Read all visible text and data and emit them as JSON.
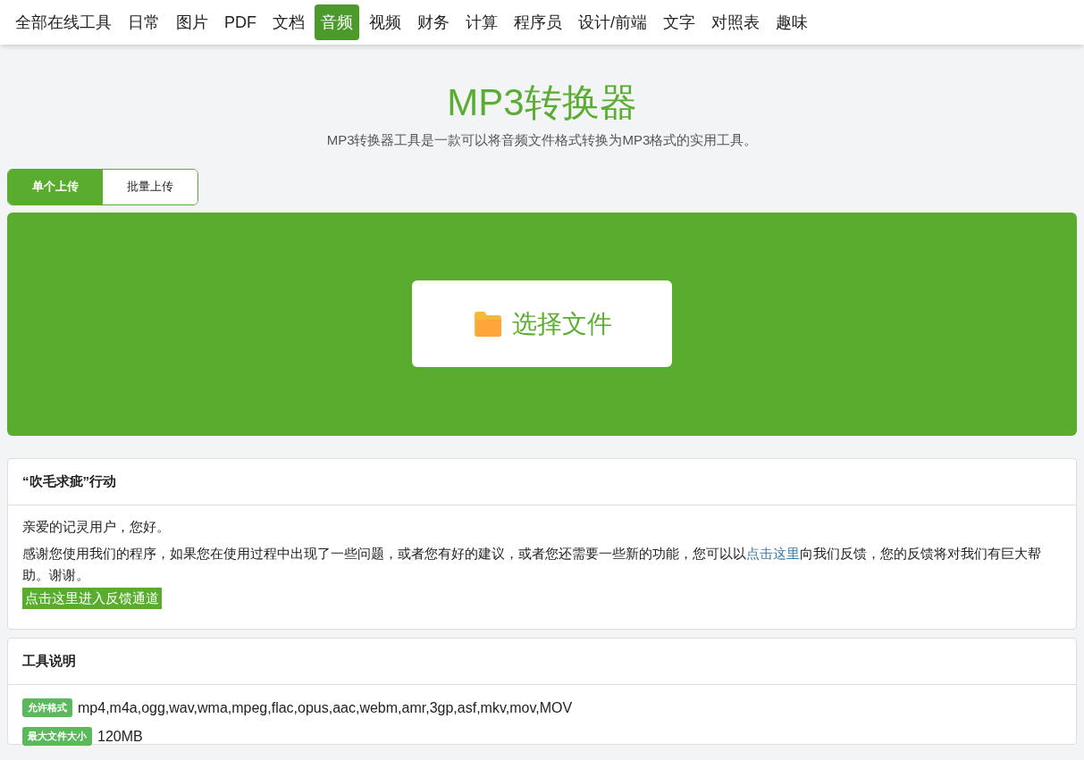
{
  "nav": [
    {
      "label": "全部在线工具",
      "selected": false
    },
    {
      "label": "日常",
      "selected": false
    },
    {
      "label": "图片",
      "selected": false
    },
    {
      "label": "PDF",
      "selected": false
    },
    {
      "label": "文档",
      "selected": false
    },
    {
      "label": "音频",
      "selected": true
    },
    {
      "label": "视频",
      "selected": false
    },
    {
      "label": "财务",
      "selected": false
    },
    {
      "label": "计算",
      "selected": false
    },
    {
      "label": "程序员",
      "selected": false
    },
    {
      "label": "设计/前端",
      "selected": false
    },
    {
      "label": "文字",
      "selected": false
    },
    {
      "label": "对照表",
      "selected": false
    },
    {
      "label": "趣味",
      "selected": false
    }
  ],
  "title": "MP3转换器",
  "subtitle": "MP3转换器工具是一款可以将音频文件格式转换为MP3格式的实用工具。",
  "upload_tabs": [
    {
      "label": "单个上传",
      "selected": true
    },
    {
      "label": "批量上传",
      "selected": false
    }
  ],
  "upload_button": "选择文件",
  "feedback_card": {
    "title": "“吹毛求疵”行动",
    "greeting": "亲爱的记灵用户，您好。",
    "text_before": "感谢您使用我们的程序，如果您在使用过程中出现了一些问题，或者您有好的建议，或者您还需要一些新的功能，您可以以",
    "link": "点击这里",
    "text_after": "向我们反馈，您的反馈将对我们有巨大帮助。谢谢。",
    "button": "点击这里进入反馈通道"
  },
  "info_card": {
    "title": "工具说明",
    "rows": [
      {
        "tag": "允许格式",
        "value": "mp4,m4a,ogg,wav,wma,mpeg,flac,opus,aac,webm,amr,3gp,asf,mkv,mov,MOV"
      },
      {
        "tag": "最大文件大小",
        "value": "120MB"
      }
    ]
  }
}
